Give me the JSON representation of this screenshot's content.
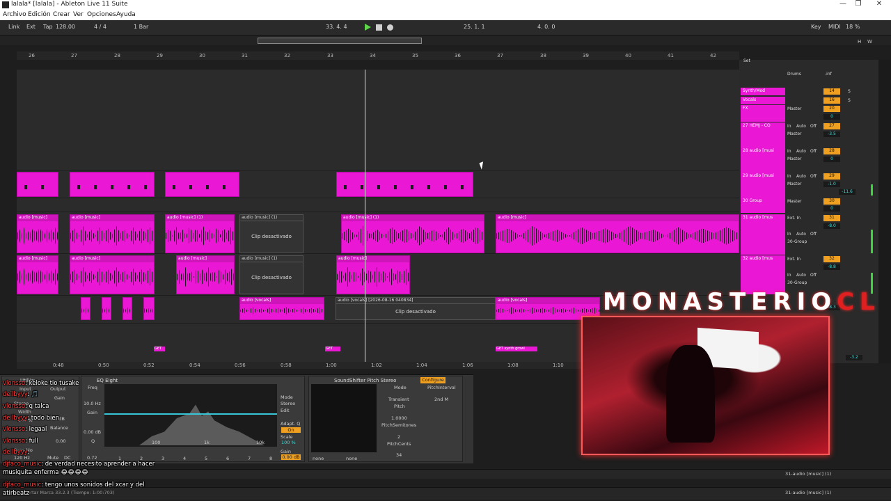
{
  "window": {
    "title": "lalala*  [lalala] - Ableton Live 11 Suite",
    "controls": [
      "—",
      "❐",
      "✕"
    ]
  },
  "menu": [
    "Archivo",
    "Edición",
    "Crear",
    "Ver",
    "Opciones",
    "Ayuda"
  ],
  "control_bar": {
    "link": "Link",
    "ext": "Ext",
    "tap": "Tap",
    "tempo": "128.00",
    "signature": "4 / 4",
    "quantize": "1 Bar",
    "position": "33.  4.  4",
    "loop_start": "25.  1.  1",
    "loop_length": "4.  0.  0",
    "key": "Key",
    "midi": "MIDI",
    "cpu": "18 %",
    "h": "H",
    "w": "W"
  },
  "ruler_bars": [
    "26",
    "27",
    "28",
    "29",
    "30",
    "31",
    "32",
    "33",
    "34",
    "35",
    "36",
    "37",
    "38",
    "39",
    "40",
    "41",
    "42"
  ],
  "time_ruler": [
    "0:48",
    "0:50",
    "0:52",
    "0:54",
    "0:56",
    "0:58",
    "1:00",
    "1:02",
    "1:04",
    "1:06",
    "1:08",
    "1:10"
  ],
  "clips": {
    "music_label": "audio [music]",
    "music_1": "audio [music] (1)",
    "vocals": "audio [vocals]",
    "vocals_rec": "audio [vocals] [2026-08-16 040834]",
    "deactivated": "Clip desactivado",
    "loc_get": "GET",
    "loc_synth": "GET  synth  growl"
  },
  "mixer": {
    "set_label": "Set",
    "tracks": [
      {
        "name": "Synth/Mod",
        "num": "14"
      },
      {
        "name": "Vocals",
        "num": "16"
      },
      {
        "name": "FX",
        "num": "20"
      },
      {
        "name": "27 HEMJ - CO",
        "num": "27"
      },
      {
        "name": "28 audio [musi",
        "num": "28"
      },
      {
        "name": "29 audio [musi",
        "num": "29"
      },
      {
        "name": "30 Group",
        "num": "30"
      },
      {
        "name": "31 audio [mus",
        "num": "31"
      },
      {
        "name": "32 audio [mus",
        "num": "32"
      }
    ],
    "drums": "Drums",
    "master": "Master",
    "ext_in": "Ext. In",
    "group_30": "30-Group",
    "in": "In",
    "auto": "Auto",
    "off": "Off",
    "inf": "-inf",
    "vals": [
      "0",
      "-3.5",
      "0",
      "-1.0",
      "-11.6",
      "0",
      "-8.0",
      "-8.8",
      "-8.3",
      "-3.2"
    ],
    "s": "S",
    "c": "C",
    "one": "1"
  },
  "devices": {
    "utility": {
      "title": "Utility",
      "labels": [
        "Input",
        "Output",
        "Gain",
        "Stereo",
        "Width",
        "Balance",
        "Bass Mo",
        "Mute",
        "DC"
      ],
      "values": [
        "0.0 dB",
        "100 %",
        "0.00",
        "120 Hz"
      ]
    },
    "eq": {
      "title": "EQ Eight",
      "freq": "Freq",
      "freq_val": "10.0 Hz",
      "gain": "Gain",
      "gain_val": "0.00 dB",
      "q": "Q",
      "q_val": "0.72",
      "mode": "Mode",
      "stereo": "Stereo",
      "edit": "Edit",
      "adapt": "Adapt. Q",
      "on": "On",
      "scale": "Scale",
      "scale_val": "100 %",
      "gain2": "Gain",
      "gain2_val": "0.00 dB",
      "grid": [
        "100",
        "1k",
        "10k"
      ],
      "bands": [
        "1",
        "2",
        "3",
        "4",
        "5",
        "6",
        "7",
        "8"
      ]
    },
    "soundshifter": {
      "title": "SoundShifter Pitch Stereo",
      "configure": "Configure",
      "mode": "Mode",
      "mode_val": "Transient",
      "pitch": "Pitch",
      "pitch_val": "1.0000",
      "interval": "PitchInterval",
      "interval_val": "2nd M",
      "semis": "PitchSemitones",
      "semis_val": "2",
      "cents": "PitchCents",
      "cents_val": "34",
      "none1": "none",
      "none2": "none"
    }
  },
  "status": {
    "row1_track": "31-audio [music] (1)",
    "row2_track": "31-audio [music] (1)",
    "insert_marker": "Insertar Marca 33.2.3 (Tiempo: 1:00:703)"
  },
  "stream": {
    "brand": "MONASTERIO",
    "brand_suffix": "CL"
  },
  "chat": [
    {
      "user": "vlonsso",
      "text": ": keloke tio tusake"
    },
    {
      "user": "deilbyyy",
      "text": ": 🎵"
    },
    {
      "user": "vlonsso",
      "text": ": q talca"
    },
    {
      "user": "deilbyyy",
      "text": ": todo bien"
    },
    {
      "user": "vlonsso",
      "text": ": legaal"
    },
    {
      "user": "vlonsso",
      "text": ": full"
    },
    {
      "user": "deilbyyy",
      "text": ": "
    },
    {
      "user": "djfaco_music",
      "text": ": de verdad necesito aprender a hacer musiquita enferma 😂😂😂😂"
    },
    {
      "user": "djfaco_music",
      "text": ": tengo unos sonidos del xcar y del atirbeatz"
    }
  ],
  "colors": {
    "clip": "#ea18d4",
    "accent": "#f0a020",
    "play": "#5ed84a",
    "brand_red": "#e02020"
  }
}
